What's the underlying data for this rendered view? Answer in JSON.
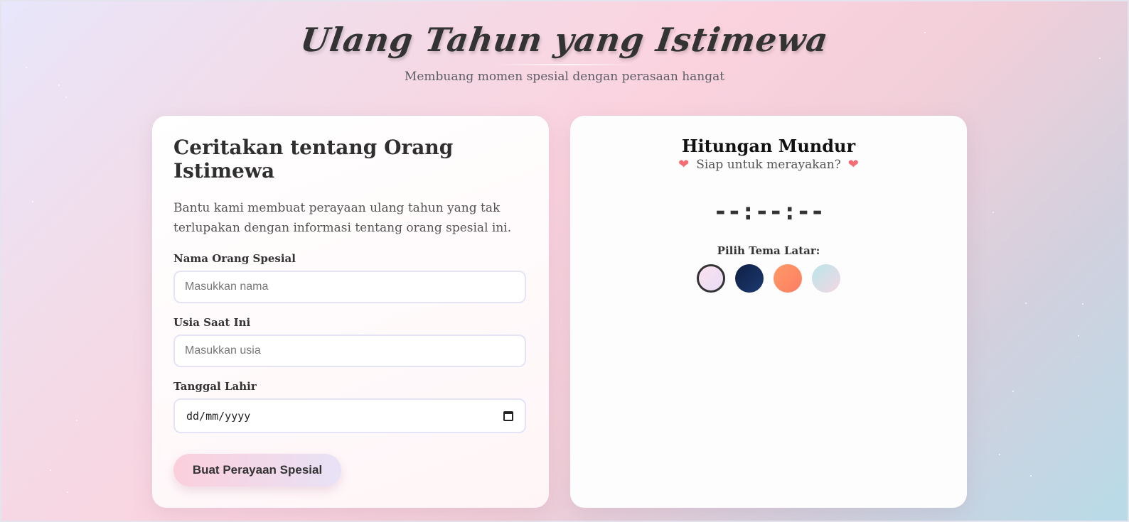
{
  "header": {
    "title": "Ulang Tahun yang Istimewa",
    "subtitle": "Membuang momen spesial dengan perasaan hangat"
  },
  "form": {
    "heading": "Ceritakan tentang Orang Istimewa",
    "description": "Bantu kami membuat perayaan ulang tahun yang tak terlupakan dengan informasi tentang orang spesial ini.",
    "name_label": "Nama Orang Spesial",
    "name_placeholder": "Masukkan nama",
    "age_label": "Usia Saat Ini",
    "age_placeholder": "Masukkan usia",
    "date_label": "Tanggal Lahir",
    "date_placeholder": "dd/mm/yyyy",
    "submit_label": "Buat Perayaan Spesial"
  },
  "countdown": {
    "title": "Hitungan Mundur",
    "subtitle": "Siap untuk merayakan?",
    "value": "--:--:--",
    "theme_label": "Pilih Tema Latar:",
    "themes": [
      {
        "name": "pink-lavender",
        "selected": true
      },
      {
        "name": "navy",
        "selected": false
      },
      {
        "name": "orange",
        "selected": false
      },
      {
        "name": "mint-pink",
        "selected": false
      }
    ]
  },
  "icons": {
    "heart": "heart-icon",
    "calendar": "calendar-icon"
  },
  "colors": {
    "heart": "#f56c75",
    "text_dark": "#333333"
  }
}
